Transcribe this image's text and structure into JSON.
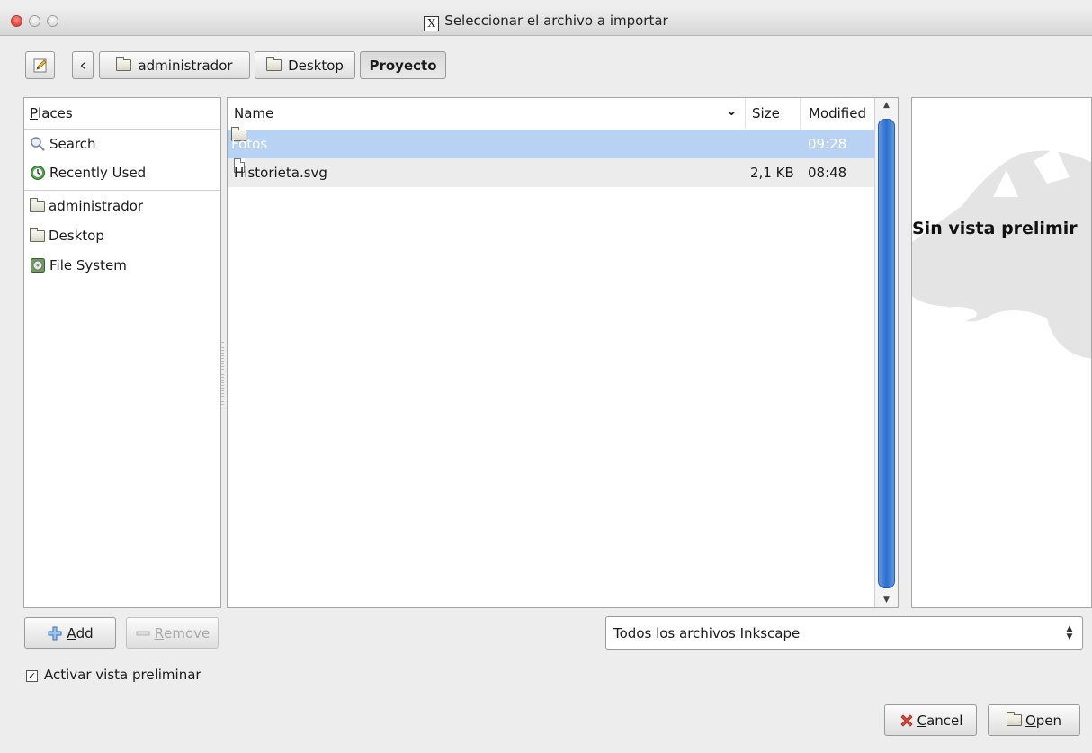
{
  "window": {
    "title": "Seleccionar el archivo a importar",
    "x11_glyph": "X"
  },
  "toolbar": {
    "edit_icon": "pencil-edit-icon",
    "back_glyph": "‹",
    "path": [
      "administrador",
      "Desktop",
      "Proyecto"
    ],
    "current_index": 2
  },
  "places": {
    "header_first": "P",
    "header_rest": "laces",
    "items": [
      {
        "label": "Search",
        "icon": "magnifier-icon"
      },
      {
        "label": "Recently Used",
        "icon": "clock-icon"
      },
      {
        "label": "administrador",
        "icon": "folder-icon"
      },
      {
        "label": "Desktop",
        "icon": "folder-icon"
      },
      {
        "label": "File System",
        "icon": "drive-icon"
      }
    ],
    "add_first": "A",
    "add_rest": "dd",
    "remove_first": "R",
    "remove_rest": "emove"
  },
  "files": {
    "columns": {
      "name": "Name",
      "size": "Size",
      "modified": "Modified"
    },
    "sort_glyph": "⌄",
    "rows": [
      {
        "name": "Fotos",
        "size": "",
        "modified": "09:28",
        "type": "folder",
        "selected": true
      },
      {
        "name": "Historieta.svg",
        "size": "2,1 KB",
        "modified": "08:48",
        "type": "file",
        "selected": false
      }
    ]
  },
  "preview": {
    "text": "Sin vista prelimir"
  },
  "filter": {
    "value": "Todos los archivos Inkscape",
    "glyph": "⌃⌄"
  },
  "options": {
    "preview_checkbox_label": "Activar vista preliminar",
    "preview_checked": true,
    "check_glyph": "✓"
  },
  "actions": {
    "cancel_first": "C",
    "cancel_rest": "ancel",
    "open_first": "O",
    "open_rest": "pen"
  },
  "colors": {
    "selection": "#b7d2f3",
    "accent": "#2c6fd0"
  }
}
